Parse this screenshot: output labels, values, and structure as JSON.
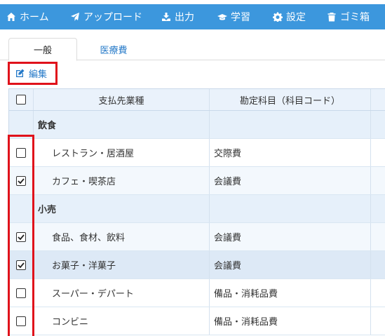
{
  "nav": {
    "items": [
      {
        "label": "ホーム",
        "icon": "home-icon"
      },
      {
        "label": "アップロード",
        "icon": "send-icon"
      },
      {
        "label": "出力",
        "icon": "download-icon"
      },
      {
        "label": "学習",
        "icon": "graduation-cap-icon"
      },
      {
        "label": "設定",
        "icon": "gear-icon"
      },
      {
        "label": "ゴミ箱",
        "icon": "trash-icon"
      }
    ],
    "background": "#3c97dd"
  },
  "tabs": [
    {
      "label": "一般",
      "active": true
    },
    {
      "label": "医療費",
      "active": false
    }
  ],
  "toolbar": {
    "edit_label": "編集",
    "edit_icon": "edit-icon"
  },
  "table": {
    "headers": {
      "payee": "支払先業種",
      "account": "勘定科目（科目コード）"
    },
    "rows": [
      {
        "type": "category",
        "name": "飲食",
        "account": ""
      },
      {
        "type": "item",
        "name": "レストラン・居酒屋",
        "account": "交際費",
        "checked": false
      },
      {
        "type": "item",
        "name": "カフェ・喫茶店",
        "account": "会議費",
        "checked": true
      },
      {
        "type": "category",
        "name": "小売",
        "account": ""
      },
      {
        "type": "item",
        "name": "食品、食材、飲料",
        "account": "会議費",
        "checked": true
      },
      {
        "type": "item",
        "name": "お菓子・洋菓子",
        "account": "会議費",
        "checked": true
      },
      {
        "type": "item",
        "name": "スーパー・デパート",
        "account": "備品・消耗品費",
        "checked": false
      },
      {
        "type": "item",
        "name": "コンビニ",
        "account": "備品・消耗品費",
        "checked": false
      }
    ]
  },
  "colors": {
    "accent": "#2479c8",
    "highlight_border": "#e0121b"
  }
}
